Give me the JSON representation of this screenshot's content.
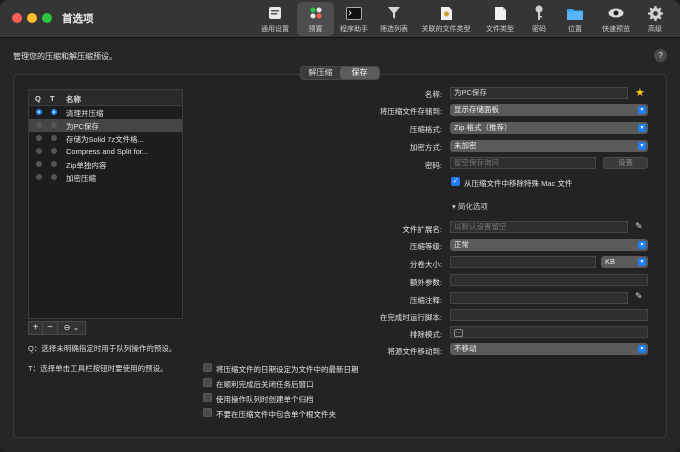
{
  "window": {
    "title": "首选项"
  },
  "toolbar": {
    "items": [
      {
        "label": "通用设置",
        "icon": "general-icon"
      },
      {
        "label": "预置",
        "icon": "presets-icon"
      },
      {
        "label": "程序助手",
        "icon": "terminal-icon"
      },
      {
        "label": "筛选列表",
        "icon": "filter-icon"
      },
      {
        "label": "关联的文件类型",
        "icon": "file-association-icon"
      },
      {
        "label": "文件类型",
        "icon": "file-type-icon"
      },
      {
        "label": "密码",
        "icon": "key-icon"
      },
      {
        "label": "位置",
        "icon": "folder-icon"
      },
      {
        "label": "快速预览",
        "icon": "eye-icon"
      },
      {
        "label": "高级",
        "icon": "gear-icon"
      }
    ]
  },
  "heading": "管理您的压缩和解压缩预设。",
  "segment": {
    "left": "解压缩",
    "right": "保存"
  },
  "table": {
    "headers": {
      "q": "Q",
      "t": "T",
      "name": "名称"
    },
    "rows": [
      {
        "q": true,
        "t": true,
        "name": "清理并压缩"
      },
      {
        "q": false,
        "t": false,
        "name": "为PC保存"
      },
      {
        "q": false,
        "t": false,
        "name": "存储为Solid 7z文件格..."
      },
      {
        "q": false,
        "t": false,
        "name": "Compress and Split for..."
      },
      {
        "q": false,
        "t": false,
        "name": "Zip单独内容"
      },
      {
        "q": false,
        "t": false,
        "name": "加密压缩"
      }
    ],
    "buttons": {
      "add": "+",
      "remove": "−",
      "more": "⊖"
    }
  },
  "notes": {
    "q": "Q：选择未明确指定时用于队列操作的预设。",
    "t": "T：选择单击工具栏按钮时要使用的预设。"
  },
  "form": {
    "name": {
      "label": "名称:",
      "value": "为PC保存"
    },
    "save_to": {
      "label": "将压缩文件存储到:",
      "value": "显示存储面板"
    },
    "format": {
      "label": "压缩格式:",
      "value": "Zip 格式（推荐）"
    },
    "encryption": {
      "label": "加密方式:",
      "value": "未加密"
    },
    "password": {
      "label": "密码:",
      "placeholder": "留空保存询问",
      "button": "设置"
    },
    "remove_mac": "从压缩文件中移除特殊 Mac 文件",
    "simplify": "简化选项",
    "extension": {
      "label": "文件扩展名:",
      "placeholder": "以默认设置留空"
    },
    "level": {
      "label": "压缩等级:",
      "value": "正常"
    },
    "split": {
      "label": "分卷大小:",
      "unit": "KB"
    },
    "extra": {
      "label": "额外参数:"
    },
    "comment": {
      "label": "压缩注释:"
    },
    "script": {
      "label": "在完成时运行脚本:"
    },
    "exclude": {
      "label": "排除模式:"
    },
    "move_source": {
      "label": "将源文件移动到:",
      "value": "不移动"
    }
  },
  "checks": [
    {
      "label": "将压缩文件的日期设定为文件中的最新日期",
      "checked": false
    },
    {
      "label": "在顺利完成后关闭任务后窗口",
      "checked": false
    },
    {
      "label": "使用操作队列时创建单个归档",
      "checked": false
    },
    {
      "label": "不要在压缩文件中包含单个根文件夹",
      "checked": false
    }
  ]
}
